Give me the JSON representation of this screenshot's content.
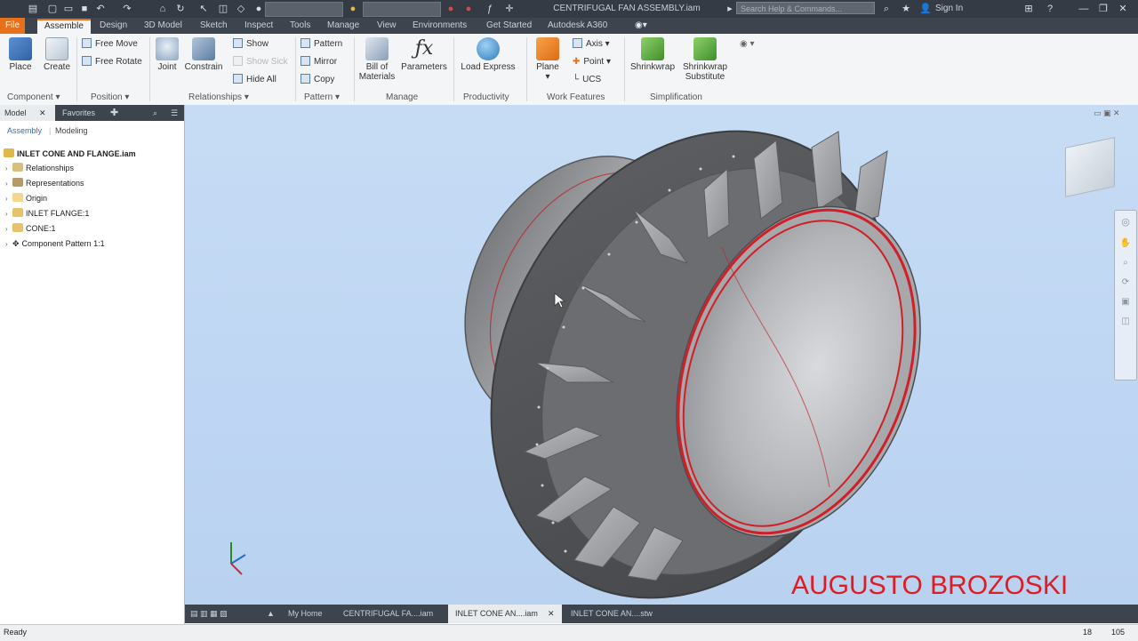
{
  "title_bar": {
    "document_title": "CENTRIFUGAL FAN ASSEMBLY.iam",
    "search_placeholder": "Search Help & Commands...",
    "sign_in": "Sign In"
  },
  "ribbon_tabs": [
    "File",
    "Assemble",
    "Design",
    "3D Model",
    "Sketch",
    "Inspect",
    "Tools",
    "Manage",
    "View",
    "Environments",
    "Get Started",
    "Autodesk A360"
  ],
  "ribbon": {
    "component": {
      "label": "Component",
      "place": "Place",
      "create": "Create"
    },
    "position": {
      "label": "Position",
      "free_move": "Free Move",
      "free_rotate": "Free Rotate"
    },
    "relationships": {
      "label": "Relationships",
      "joint": "Joint",
      "constrain": "Constrain",
      "show": "Show",
      "show_sick": "Show Sick",
      "hide_all": "Hide All"
    },
    "pattern": {
      "label": "Pattern",
      "pattern": "Pattern",
      "mirror": "Mirror",
      "copy": "Copy"
    },
    "manage": {
      "label": "Manage",
      "bom_line1": "Bill of",
      "bom_line2": "Materials",
      "parameters": "Parameters"
    },
    "productivity": {
      "label": "Productivity",
      "load_express": "Load Express"
    },
    "work_features": {
      "label": "Work Features",
      "plane": "Plane",
      "axis": "Axis",
      "point": "Point",
      "ucs": "UCS"
    },
    "simplification": {
      "label": "Simplification",
      "shrinkwrap": "Shrinkwrap",
      "shrinkwrap_sub_line1": "Shrinkwrap",
      "shrinkwrap_sub_line2": "Substitute"
    }
  },
  "browser": {
    "tabs": [
      "Model",
      "Favorites"
    ],
    "subtabs": [
      "Assembly",
      "Modeling"
    ],
    "root": "INLET CONE AND FLANGE.iam",
    "items": [
      "Relationships",
      "Representations",
      "Origin",
      "INLET FLANGE:1",
      "CONE:1",
      "Component Pattern 1:1"
    ]
  },
  "document_tabs": {
    "home": "My Home",
    "tab1": "CENTRIFUGAL FA....iam",
    "tab2": "INLET CONE AN....iam",
    "tab3": "INLET CONE AN....stw"
  },
  "status": {
    "left": "Ready",
    "num1": "18",
    "num2": "105"
  },
  "watermark": "AUGUSTO BROZOSKI",
  "colors": {
    "accent": "#e8701a",
    "highlight_red": "#e01b22",
    "viewport_bg": "#c2d8f3",
    "model_grey": "#8a8c90"
  }
}
